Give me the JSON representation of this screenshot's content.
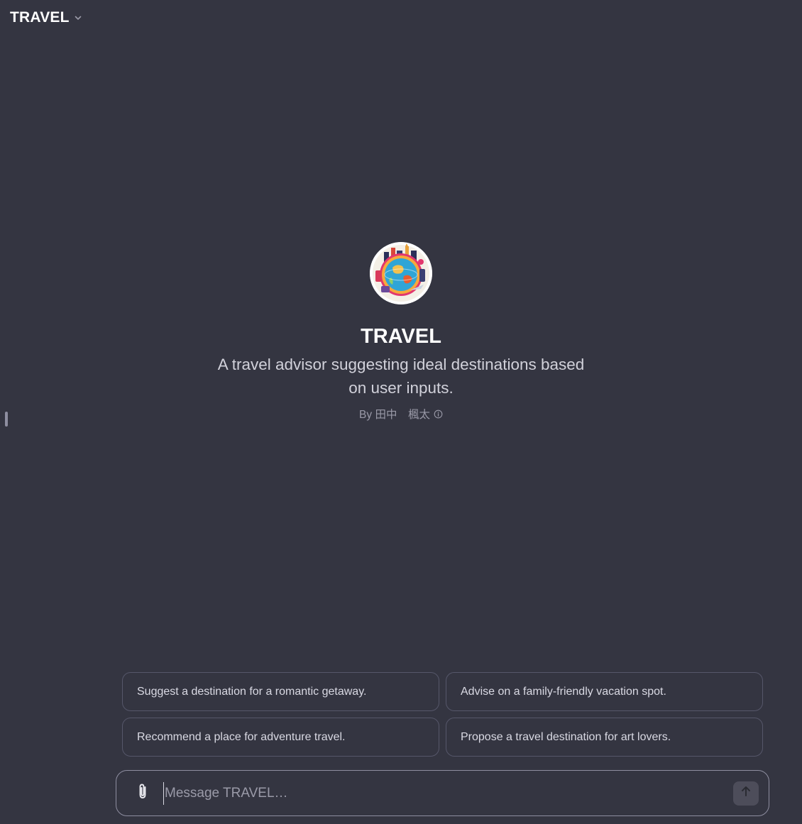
{
  "header": {
    "model_name": "TRAVEL",
    "chevron_icon": "chevron-down-icon"
  },
  "gpt": {
    "avatar_icon": "globe-travel-avatar",
    "title": "TRAVEL",
    "description": "A travel advisor suggesting ideal destinations based on user inputs.",
    "author": "By 田中　楓太",
    "info_icon": "info-icon"
  },
  "starters": [
    {
      "label": "Suggest a destination for a romantic getaway."
    },
    {
      "label": "Advise on a family-friendly vacation spot."
    },
    {
      "label": "Recommend a place for adventure travel."
    },
    {
      "label": "Propose a travel destination for art lovers."
    }
  ],
  "composer": {
    "placeholder": "Message TRAVEL…",
    "value": "",
    "attach_icon": "paperclip-icon",
    "send_icon": "arrow-up-icon"
  },
  "colors": {
    "background": "#343541",
    "card_border": "#56576a",
    "composer_border": "#8e8ea0",
    "send_button": "#4d4d5a"
  }
}
